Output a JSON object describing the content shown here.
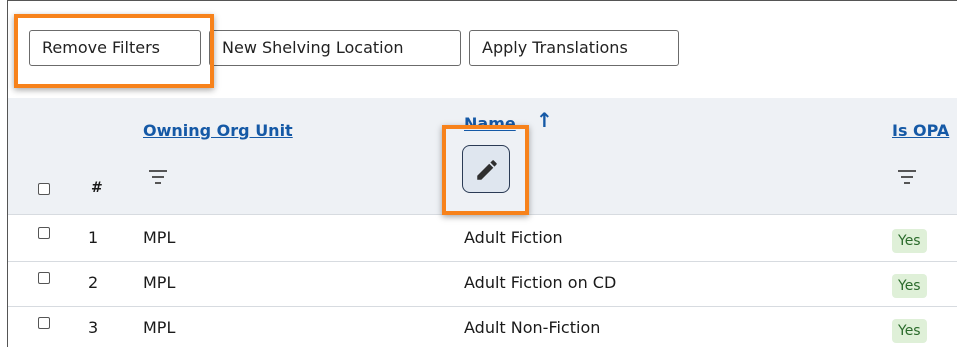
{
  "toolbar": {
    "remove_filters": "Remove Filters",
    "new_shelving_location": "New Shelving Location",
    "apply_translations": "Apply Translations"
  },
  "table": {
    "row_number_header": "#",
    "columns": {
      "owning_org_unit": "Owning Org Unit",
      "name": "Name",
      "is_opac": "Is OPA"
    },
    "sort": {
      "column": "name",
      "direction": "ascending"
    },
    "rows": [
      {
        "num": "1",
        "org": "MPL",
        "name": "Adult Fiction",
        "opac": "Yes"
      },
      {
        "num": "2",
        "org": "MPL",
        "name": "Adult Fiction on CD",
        "opac": "Yes"
      },
      {
        "num": "3",
        "org": "MPL",
        "name": "Adult Non-Fiction",
        "opac": "Yes"
      }
    ]
  },
  "icons": {
    "filter": "filter-icon",
    "edit": "pencil-icon",
    "sort": "arrow-up-icon"
  },
  "colors": {
    "highlight": "#f7821b",
    "link": "#1559a6",
    "yes_badge_bg": "#dff0d8",
    "header_bg": "#eef1f5"
  }
}
